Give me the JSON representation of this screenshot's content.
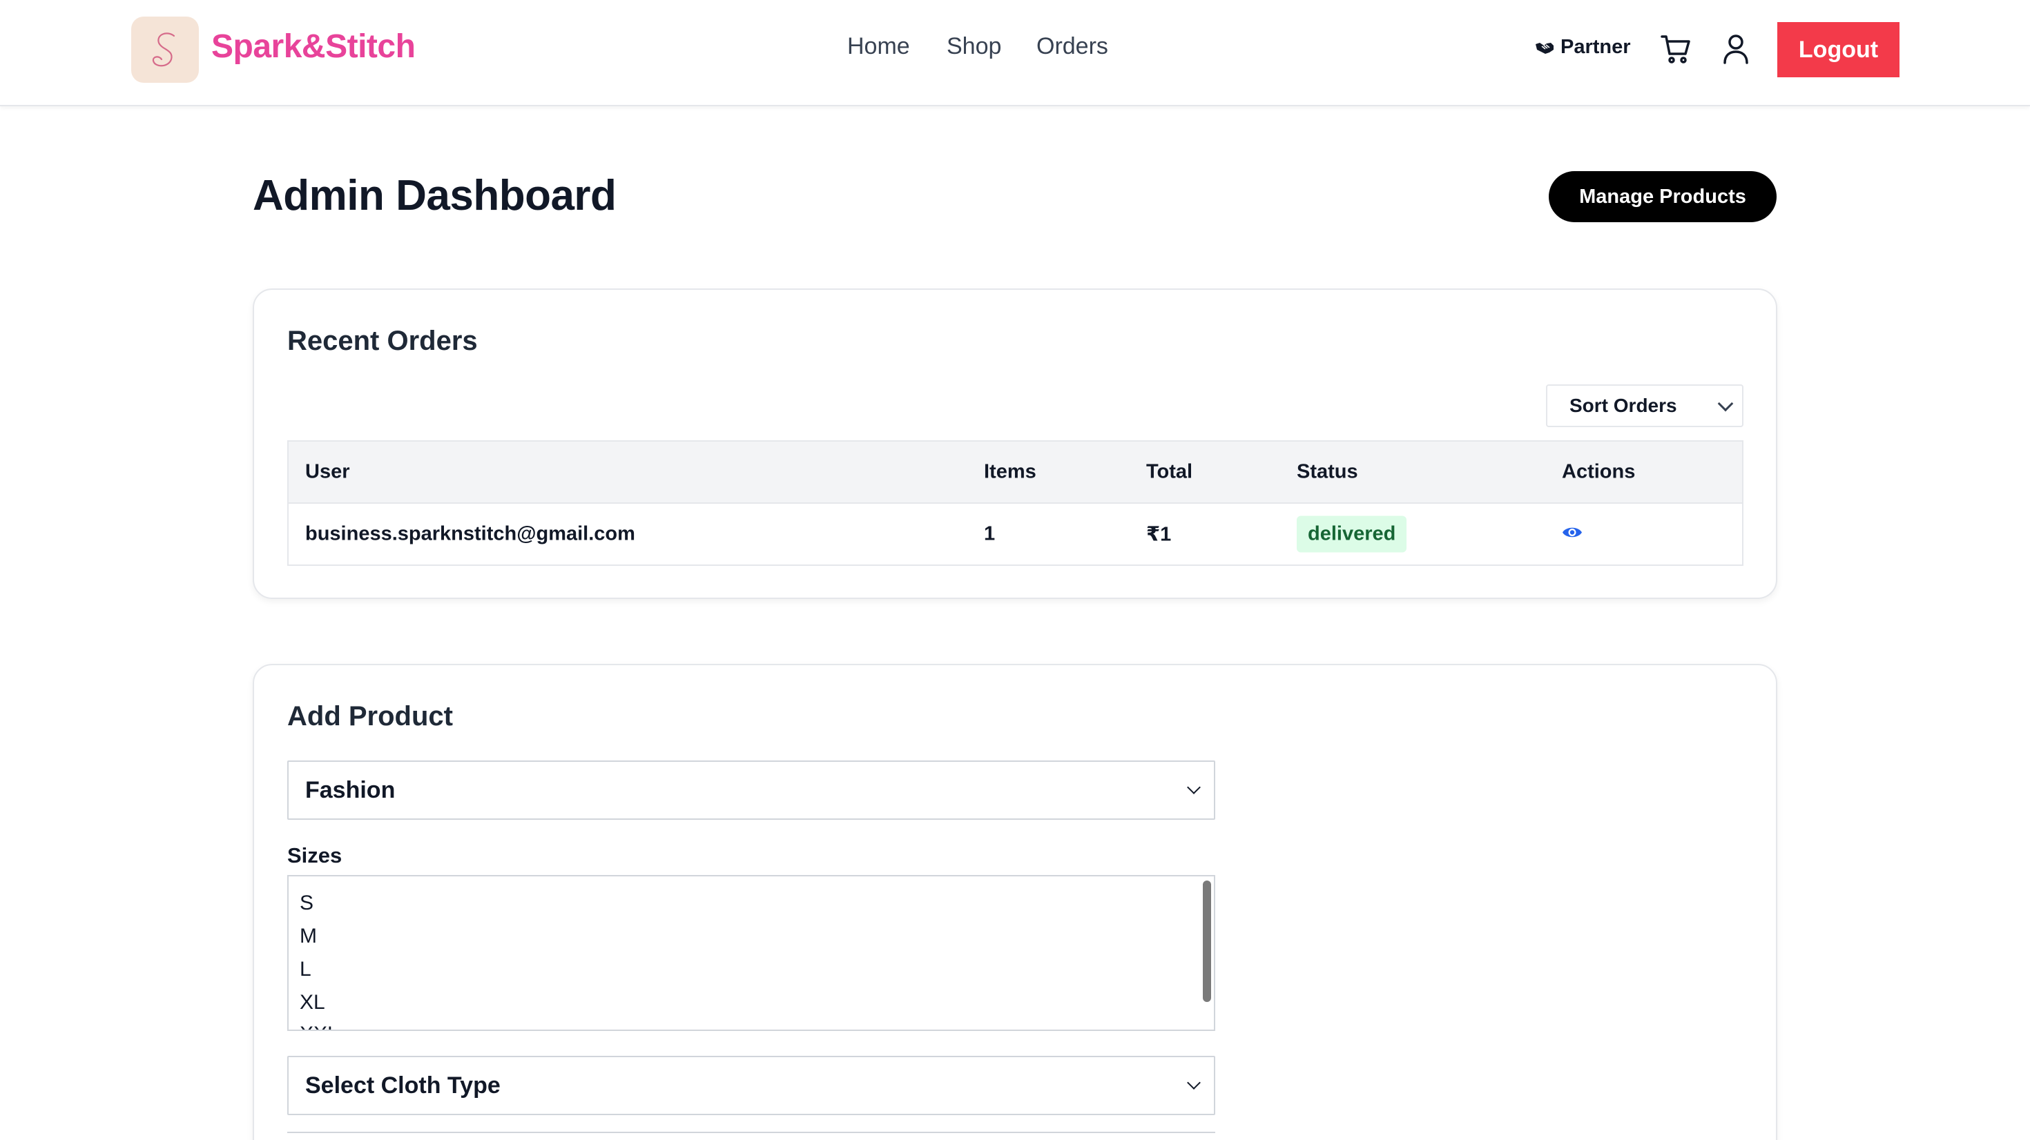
{
  "header": {
    "brand": "Spark&Stitch",
    "nav": {
      "home": "Home",
      "shop": "Shop",
      "orders": "Orders"
    },
    "partner_label": "Partner",
    "logout_label": "Logout"
  },
  "page": {
    "title": "Admin Dashboard",
    "manage_products_label": "Manage Products"
  },
  "recent_orders": {
    "title": "Recent Orders",
    "sort_label": "Sort Orders",
    "columns": [
      "User",
      "Items",
      "Total",
      "Status",
      "Actions"
    ],
    "rows": [
      {
        "user": "business.sparknstitch@gmail.com",
        "items": "1",
        "total": "₹1",
        "status": "delivered"
      }
    ]
  },
  "add_product": {
    "title": "Add Product",
    "category_value": "Fashion",
    "sizes_label": "Sizes",
    "sizes": [
      "S",
      "M",
      "L",
      "XL",
      "XXL"
    ],
    "cloth_type_value": "Select Cloth Type"
  },
  "colors": {
    "brand": "#e8439a",
    "logout": "#f33a4a",
    "badge_bg": "#dcfce7",
    "badge_text": "#166534",
    "eye": "#2563eb"
  },
  "icons": [
    "logo-s-icon",
    "handshake-icon",
    "cart-icon",
    "user-icon",
    "eye-icon",
    "chevron-down-icon"
  ]
}
